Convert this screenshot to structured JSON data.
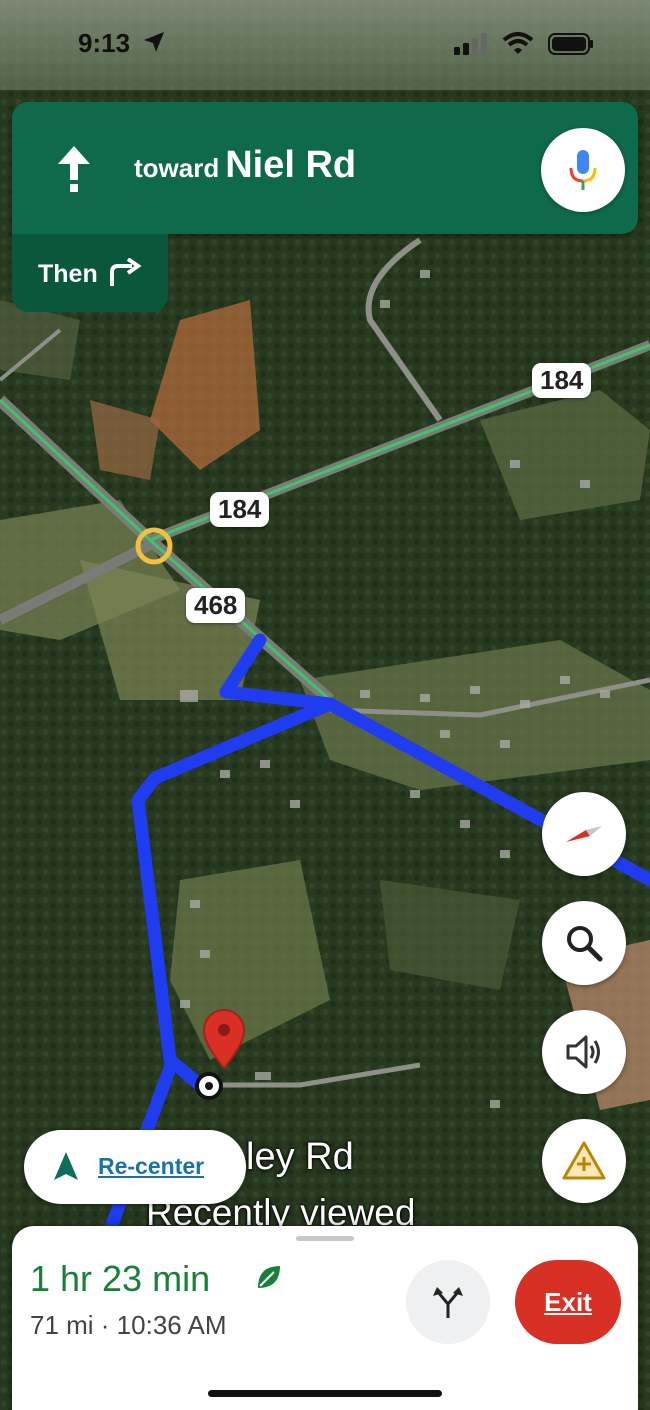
{
  "status_bar": {
    "time": "9:13"
  },
  "banner": {
    "toward_label": "toward",
    "street": "Niel Rd",
    "then_label": "Then"
  },
  "map": {
    "shields": [
      "184",
      "184",
      "468"
    ],
    "place_name": "Boley Rd",
    "place_name_visible": "ley Rd",
    "place_subtitle": "Recently viewed"
  },
  "recenter": {
    "label": "Re-center"
  },
  "trip": {
    "duration": "1 hr 23 min",
    "distance_eta": "71 mi · 10:36 AM",
    "exit_label": "Exit"
  },
  "colors": {
    "banner": "#0e6a4a",
    "route": "#1f3cf0",
    "exit": "#d93025",
    "duration": "#188038"
  },
  "icons": [
    "location-arrow-icon",
    "signal-icon",
    "wifi-icon",
    "battery-icon",
    "straight-arrow-icon",
    "mic-icon",
    "turn-right-icon",
    "compass-icon",
    "search-icon",
    "volume-icon",
    "report-icon",
    "navigation-arrow-icon",
    "eco-leaf-icon",
    "alt-routes-icon"
  ]
}
